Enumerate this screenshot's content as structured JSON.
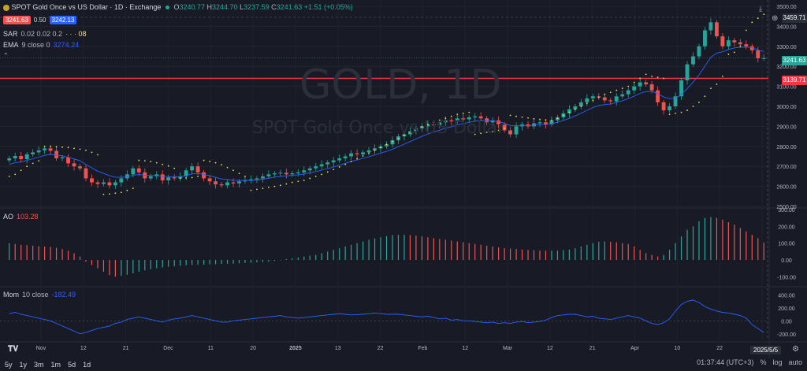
{
  "header": {
    "symbol_title": "SPOT Gold Once vs US Dollar · 1D · Exchange",
    "ohlc": {
      "o_label": "O",
      "o": "3240.77",
      "h_label": "H",
      "h": "3244.70",
      "l_label": "L",
      "l": "3237.59",
      "c_label": "C",
      "c": "3241.63",
      "chg": "+1.51 (+0.05%)"
    },
    "sell_price": "3241.63",
    "spread": "0.50",
    "buy_price": "3242.13"
  },
  "indicators": {
    "sar": {
      "label": "SAR",
      "params": "0.02 0.02 0.2",
      "value": "· · · 08"
    },
    "ema": {
      "label": "EMA",
      "params": "9 close 0",
      "value": "3274.24"
    },
    "ao": {
      "label": "AO",
      "value": "103.28"
    },
    "mom": {
      "label": "Mom",
      "params": "10 close",
      "value": "-182.49"
    }
  },
  "watermark": {
    "big": "GOLD, 1D",
    "small": "SPOT Gold Once vs US Dollar"
  },
  "price_tags": {
    "top": "3459.71",
    "last": "3241.63",
    "line": "3139.71"
  },
  "timeframes": [
    "5y",
    "1y",
    "3m",
    "1m",
    "5d",
    "1d"
  ],
  "footer": {
    "time": "01:37:44 (UTC+3)",
    "percent": "%",
    "log": "log",
    "auto": "auto",
    "date_tag": "2025/5/5"
  },
  "colors": {
    "up": "#26a69a",
    "down": "#ef5350",
    "ema": "#2962ff",
    "sar": "#f0e050",
    "mom": "#2962ff",
    "bg": "#181b25",
    "redline": "#f23645"
  },
  "chart_data": [
    {
      "type": "candlestick",
      "title": "GOLD, 1D",
      "ylim": [
        2500,
        3500
      ],
      "y_ticks": [
        2500,
        2600,
        2700,
        2800,
        2900,
        3000,
        3100,
        3200,
        3300,
        3400,
        3500
      ],
      "x_ticks": [
        "Nov",
        "12",
        "21",
        "Dec",
        "11",
        "20",
        "2025",
        "13",
        "22",
        "Feb",
        "12",
        "Mar",
        "12",
        "21",
        "Apr",
        "10",
        "22",
        "5"
      ],
      "horizontal_line": 3139.71,
      "last_close": 3241.63,
      "closes": [
        2740,
        2752,
        2736,
        2760,
        2770,
        2780,
        2790,
        2778,
        2740,
        2745,
        2715,
        2700,
        2690,
        2640,
        2620,
        2612,
        2620,
        2605,
        2620,
        2640,
        2660,
        2690,
        2670,
        2640,
        2650,
        2660,
        2630,
        2645,
        2640,
        2650,
        2680,
        2700,
        2670,
        2640,
        2625,
        2610,
        2605,
        2620,
        2615,
        2625,
        2630,
        2635,
        2640,
        2650,
        2660,
        2665,
        2668,
        2660,
        2665,
        2670,
        2680,
        2690,
        2700,
        2710,
        2720,
        2730,
        2740,
        2750,
        2765,
        2760,
        2770,
        2780,
        2790,
        2800,
        2810,
        2830,
        2850,
        2860,
        2875,
        2890,
        2900,
        2910,
        2905,
        2920,
        2930,
        2925,
        2940,
        2935,
        2945,
        2950,
        2940,
        2920,
        2930,
        2910,
        2880,
        2860,
        2900,
        2910,
        2900,
        2915,
        2920,
        2910,
        2930,
        2945,
        2965,
        2985,
        3000,
        3020,
        3040,
        3050,
        3045,
        3030,
        3025,
        3050,
        3060,
        3080,
        3100,
        3120,
        3110,
        3080,
        3020,
        2980,
        3000,
        3050,
        3130,
        3210,
        3250,
        3300,
        3380,
        3420,
        3350,
        3300,
        3330,
        3320,
        3310,
        3300,
        3280,
        3240,
        3241
      ],
      "ema": [
        2710,
        2718,
        2722,
        2730,
        2738,
        2746,
        2755,
        2760,
        2755,
        2753,
        2745,
        2737,
        2728,
        2710,
        2692,
        2676,
        2665,
        2653,
        2646,
        2645,
        2648,
        2656,
        2659,
        2655,
        2654,
        2655,
        2650,
        2649,
        2647,
        2648,
        2654,
        2663,
        2664,
        2660,
        2653,
        2645,
        2637,
        2634,
        2630,
        2629,
        2629,
        2630,
        2632,
        2636,
        2641,
        2646,
        2650,
        2652,
        2655,
        2658,
        2662,
        2668,
        2674,
        2681,
        2689,
        2697,
        2706,
        2715,
        2725,
        2732,
        2740,
        2748,
        2757,
        2766,
        2775,
        2786,
        2799,
        2811,
        2824,
        2837,
        2850,
        2862,
        2871,
        2881,
        2891,
        2898,
        2907,
        2913,
        2920,
        2926,
        2929,
        2927,
        2928,
        2924,
        2915,
        2904,
        2903,
        2905,
        2904,
        2906,
        2909,
        2909,
        2913,
        2920,
        2929,
        2940,
        2952,
        2966,
        2980,
        2994,
        3004,
        3009,
        3012,
        3020,
        3028,
        3038,
        3051,
        3065,
        3074,
        3075,
        3064,
        3047,
        3038,
        3041,
        3059,
        3089,
        3121,
        3157,
        3201,
        3245,
        3266,
        3273,
        3284,
        3292,
        3295,
        3296,
        3293,
        3282,
        3274
      ],
      "sar": [
        2650,
        2660,
        2680,
        2700,
        2715,
        2728,
        2800,
        2800,
        2798,
        2796,
        2794,
        2790,
        2786,
        2780,
        2770,
        2758,
        2560,
        2562,
        2566,
        2570,
        2580,
        2590,
        2730,
        2728,
        2724,
        2718,
        2710,
        2702,
        2690,
        2640,
        2642,
        2644,
        2650,
        2730,
        2725,
        2718,
        2708,
        2694,
        2680,
        2665,
        2650,
        2580,
        2585,
        2590,
        2595,
        2600,
        2605,
        2612,
        2620,
        2625,
        2630,
        2640,
        2650,
        2660,
        2672,
        2684,
        2697,
        2710,
        2724,
        2738,
        2752,
        2766,
        2780,
        2795,
        2810,
        2825,
        2840,
        2855,
        2870,
        2885,
        2898,
        2910,
        2920,
        2930,
        2940,
        2950,
        2960,
        2965,
        2970,
        2860,
        2865,
        2870,
        2875,
        2880,
        2890,
        2955,
        2950,
        2946,
        2942,
        2938,
        2935,
        2932,
        2930,
        2940,
        2955,
        2970,
        2985,
        3000,
        3015,
        3030,
        3045,
        3060,
        3070,
        3080,
        3090,
        3100,
        3120,
        3140,
        3160,
        3150,
        3145,
        3140,
        2960,
        2965,
        2970,
        2980,
        3000,
        3020,
        3050,
        3090,
        3110,
        3150,
        3260,
        3270,
        3300,
        3380,
        3420,
        3440,
        3460
      ]
    },
    {
      "type": "bar",
      "title": "AO",
      "ylim": [
        -150,
        300
      ],
      "y_ticks": [
        -100,
        0,
        100,
        200,
        300
      ],
      "values": [
        100,
        95,
        90,
        88,
        85,
        82,
        80,
        78,
        72,
        65,
        55,
        40,
        20,
        -10,
        -30,
        -50,
        -70,
        -90,
        -100,
        -95,
        -88,
        -80,
        -70,
        -62,
        -55,
        -50,
        -45,
        -40,
        -38,
        -35,
        -32,
        -30,
        -28,
        -28,
        -26,
        -25,
        -24,
        -23,
        -22,
        -20,
        -18,
        -16,
        -14,
        -12,
        -10,
        -5,
        0,
        5,
        10,
        15,
        20,
        25,
        30,
        40,
        50,
        60,
        70,
        80,
        90,
        100,
        110,
        120,
        128,
        135,
        142,
        148,
        150,
        150,
        148,
        145,
        140,
        135,
        130,
        125,
        120,
        115,
        110,
        105,
        100,
        95,
        90,
        85,
        80,
        75,
        70,
        68,
        65,
        62,
        60,
        58,
        56,
        55,
        55,
        56,
        58,
        62,
        70,
        80,
        90,
        100,
        108,
        110,
        108,
        105,
        100,
        95,
        80,
        60,
        40,
        30,
        20,
        30,
        60,
        100,
        140,
        180,
        200,
        230,
        250,
        255,
        250,
        240,
        225,
        210,
        190,
        170,
        150,
        130,
        103
      ]
    },
    {
      "type": "line",
      "title": "Mom",
      "ylim": [
        -300,
        500
      ],
      "y_ticks": [
        -200,
        0,
        200,
        400
      ],
      "values": [
        110,
        130,
        100,
        80,
        60,
        40,
        20,
        0,
        -40,
        -80,
        -120,
        -160,
        -200,
        -180,
        -150,
        -120,
        -100,
        -80,
        -40,
        -20,
        20,
        40,
        60,
        40,
        20,
        0,
        -20,
        10,
        30,
        40,
        60,
        80,
        60,
        40,
        20,
        0,
        -20,
        -20,
        0,
        10,
        20,
        30,
        40,
        50,
        60,
        70,
        80,
        60,
        50,
        40,
        50,
        60,
        70,
        80,
        90,
        100,
        110,
        100,
        90,
        95,
        100,
        110,
        120,
        110,
        100,
        100,
        100,
        90,
        80,
        70,
        60,
        70,
        50,
        30,
        40,
        10,
        20,
        0,
        0,
        -10,
        -20,
        -30,
        -20,
        -40,
        -30,
        -40,
        -20,
        -10,
        -30,
        -20,
        -10,
        10,
        50,
        80,
        90,
        100,
        100,
        80,
        60,
        70,
        40,
        30,
        20,
        40,
        60,
        80,
        60,
        40,
        0,
        -40,
        -60,
        -30,
        30,
        150,
        250,
        300,
        320,
        280,
        220,
        180,
        150,
        130,
        120,
        100,
        80,
        40,
        -60,
        -120,
        -182
      ]
    }
  ]
}
